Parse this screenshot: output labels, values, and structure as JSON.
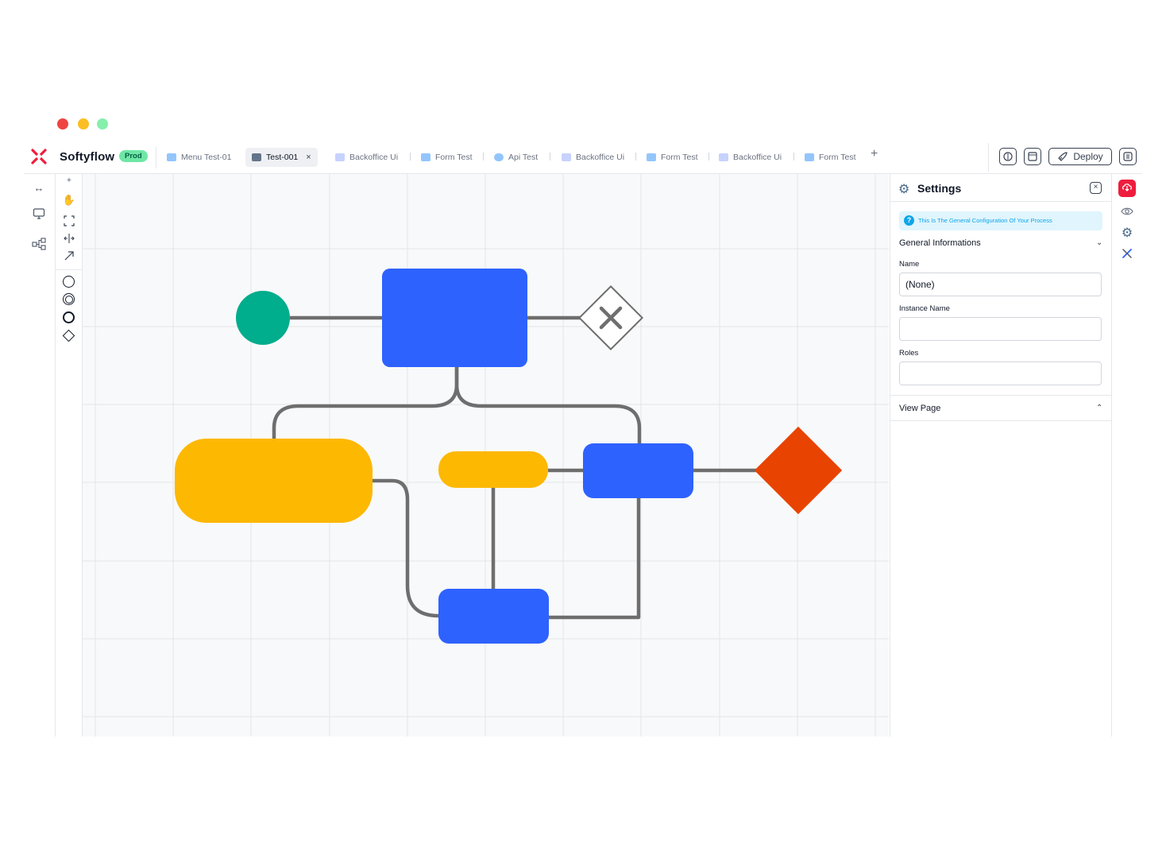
{
  "window": {
    "controls": [
      {
        "name": "close",
        "color": "#ef4444"
      },
      {
        "name": "minimize",
        "color": "#fbbf24"
      },
      {
        "name": "maximize",
        "color": "#86efac"
      }
    ]
  },
  "header": {
    "brand": "Softyflow",
    "env_badge": "Prod",
    "tabs": [
      {
        "label": "Menu Test-01",
        "icon": "menu-icon",
        "active": false
      },
      {
        "label": "Test-001",
        "icon": "ui-icon",
        "active": true,
        "close": "×"
      },
      {
        "label": "Backoffice Ui",
        "icon": "folder-icon",
        "active": false
      },
      {
        "label": "Form Test",
        "icon": "form-icon",
        "active": false
      },
      {
        "label": "Api Test",
        "icon": "api-icon",
        "active": false
      },
      {
        "label": "Backoffice Ui",
        "icon": "folder-icon",
        "active": false
      },
      {
        "label": "Form Test",
        "icon": "form-icon",
        "active": false
      },
      {
        "label": "Backoffice Ui",
        "icon": "folder-icon",
        "active": false
      },
      {
        "label": "Form Test",
        "icon": "form-icon",
        "active": false
      }
    ],
    "add_tab": "+",
    "deploy_label": "Deploy"
  },
  "settings": {
    "title": "Settings",
    "info": "This Is The General Configuration Of Your Process",
    "general_section": "General Informations",
    "fields": [
      {
        "label": "Name",
        "value": "(None)"
      },
      {
        "label": "Instance Name",
        "value": ""
      },
      {
        "label": "Roles",
        "value": ""
      }
    ],
    "view_page_section": "View Page"
  },
  "colors": {
    "blue": "#2e62ff",
    "yellow": "#fdb802",
    "green": "#00ad8c",
    "red": "#e84300",
    "connector": "#6e6e6e",
    "accent": "#ef1d3d"
  }
}
